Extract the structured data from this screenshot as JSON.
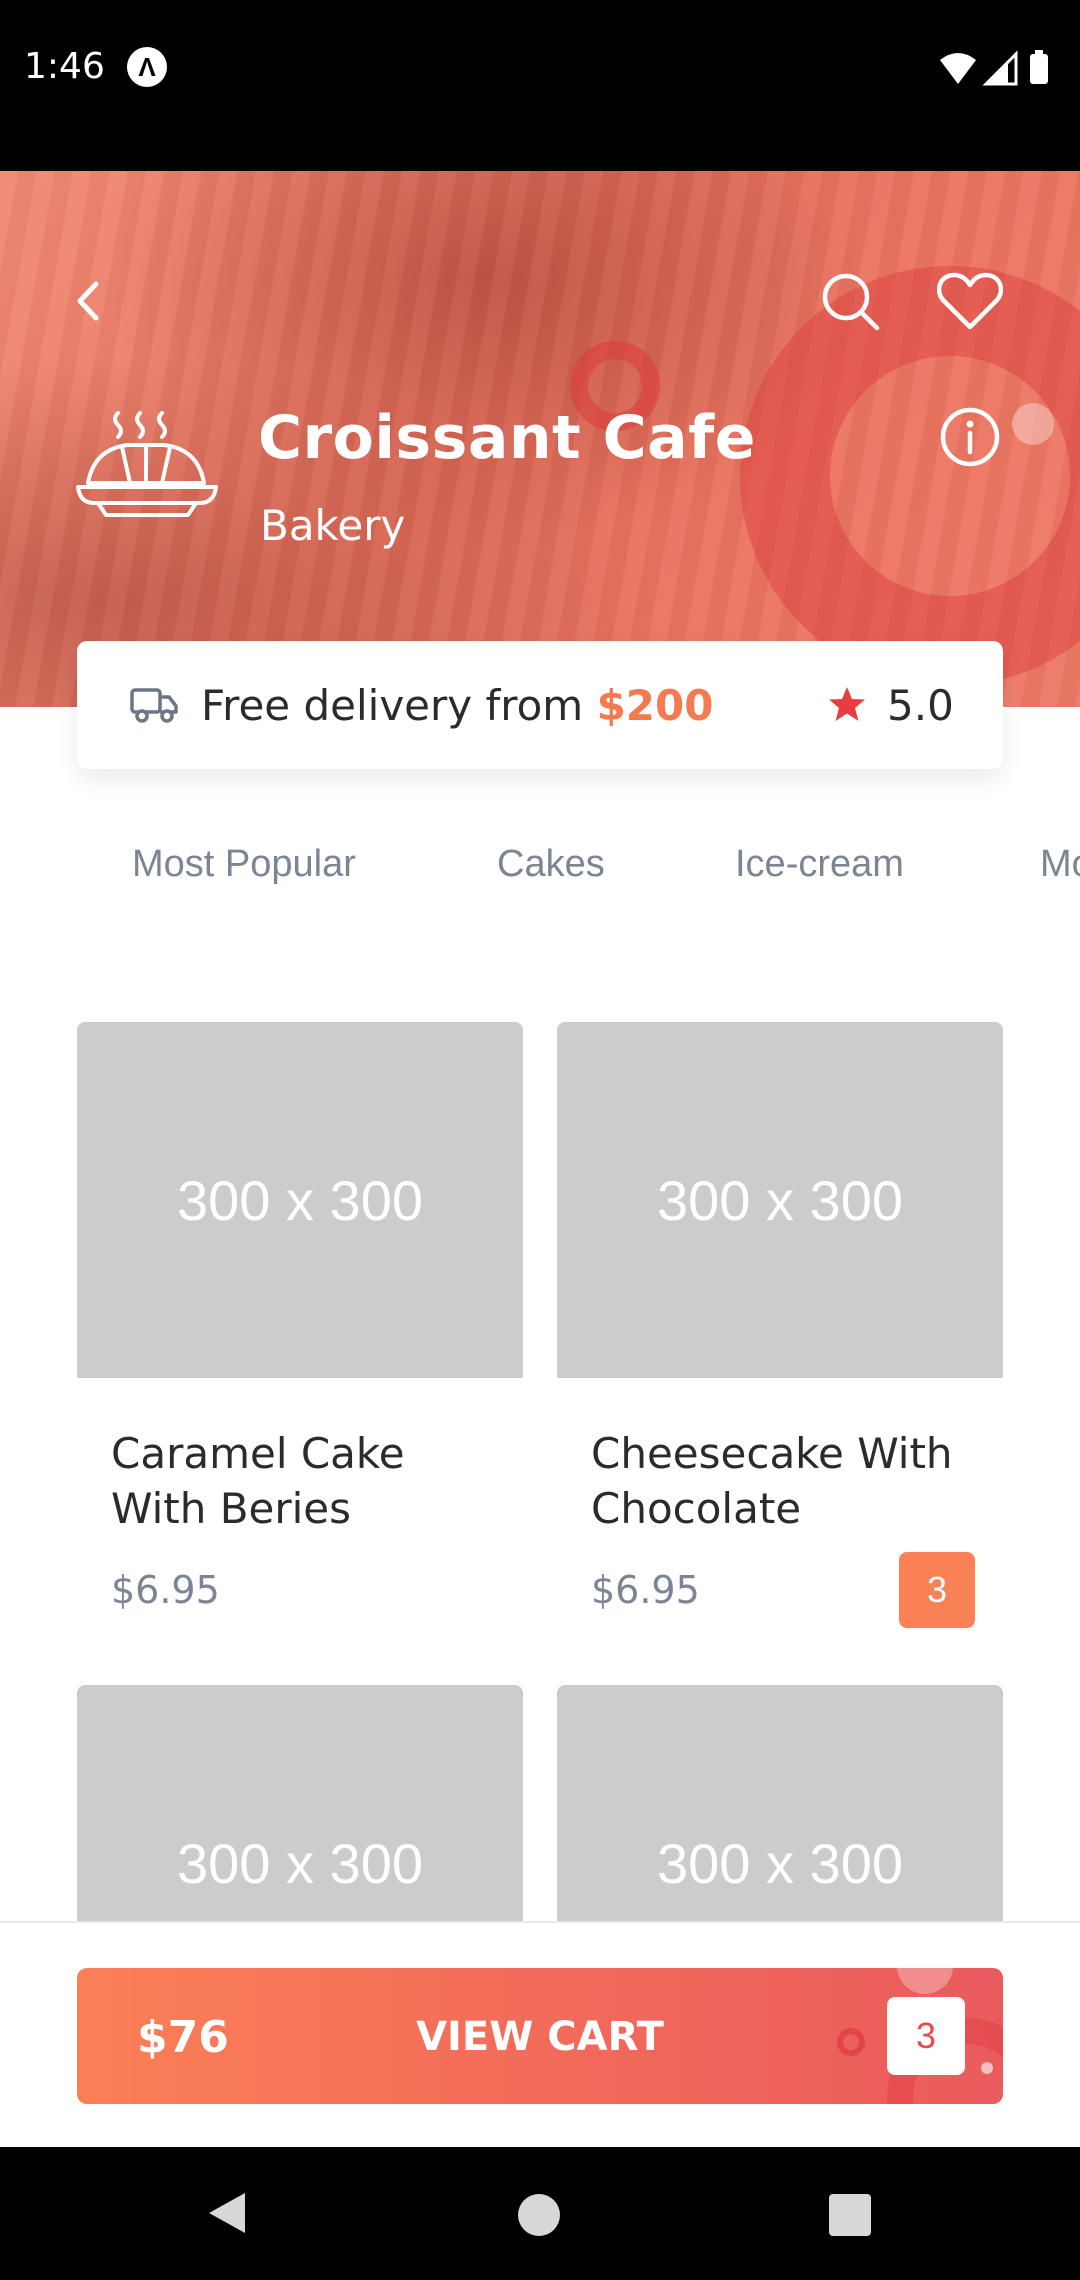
{
  "status_bar": {
    "time": "1:46",
    "app_icon_glyph": "Λ",
    "icons": [
      "wifi-icon",
      "signal-icon",
      "battery-icon"
    ]
  },
  "header": {
    "back_icon": "chevron-left-icon",
    "search_icon": "search-icon",
    "favorite_icon": "heart-icon",
    "info_icon": "info-icon",
    "shop_name": "Croissant Cafe",
    "shop_category": "Bakery",
    "logo_icon": "croissant-icon"
  },
  "info_card": {
    "delivery_prefix": "Free delivery from ",
    "delivery_amount": "$200",
    "rating": "5.0",
    "accent_color": "#f47b4f",
    "star_color": "#e83d3d"
  },
  "tabs": [
    {
      "label": "Most Popular"
    },
    {
      "label": "Cakes"
    },
    {
      "label": "Ice-cream"
    },
    {
      "label": "Mo"
    }
  ],
  "products": [
    {
      "image_placeholder": "300 x 300",
      "name": "Caramel Cake With Beries",
      "price": "$6.95",
      "quantity": ""
    },
    {
      "image_placeholder": "300 x 300",
      "name": "Cheesecake With Chocolate",
      "price": "$6.95",
      "quantity": "3"
    },
    {
      "image_placeholder": "300 x 300",
      "name": "",
      "price": "",
      "quantity": ""
    },
    {
      "image_placeholder": "300 x 300",
      "name": "",
      "price": "",
      "quantity": ""
    }
  ],
  "cart": {
    "total": "$76",
    "label": "VIEW CART",
    "count": "3"
  },
  "nav_bar": {
    "icons": [
      "nav-back-icon",
      "nav-home-icon",
      "nav-recents-icon"
    ]
  }
}
